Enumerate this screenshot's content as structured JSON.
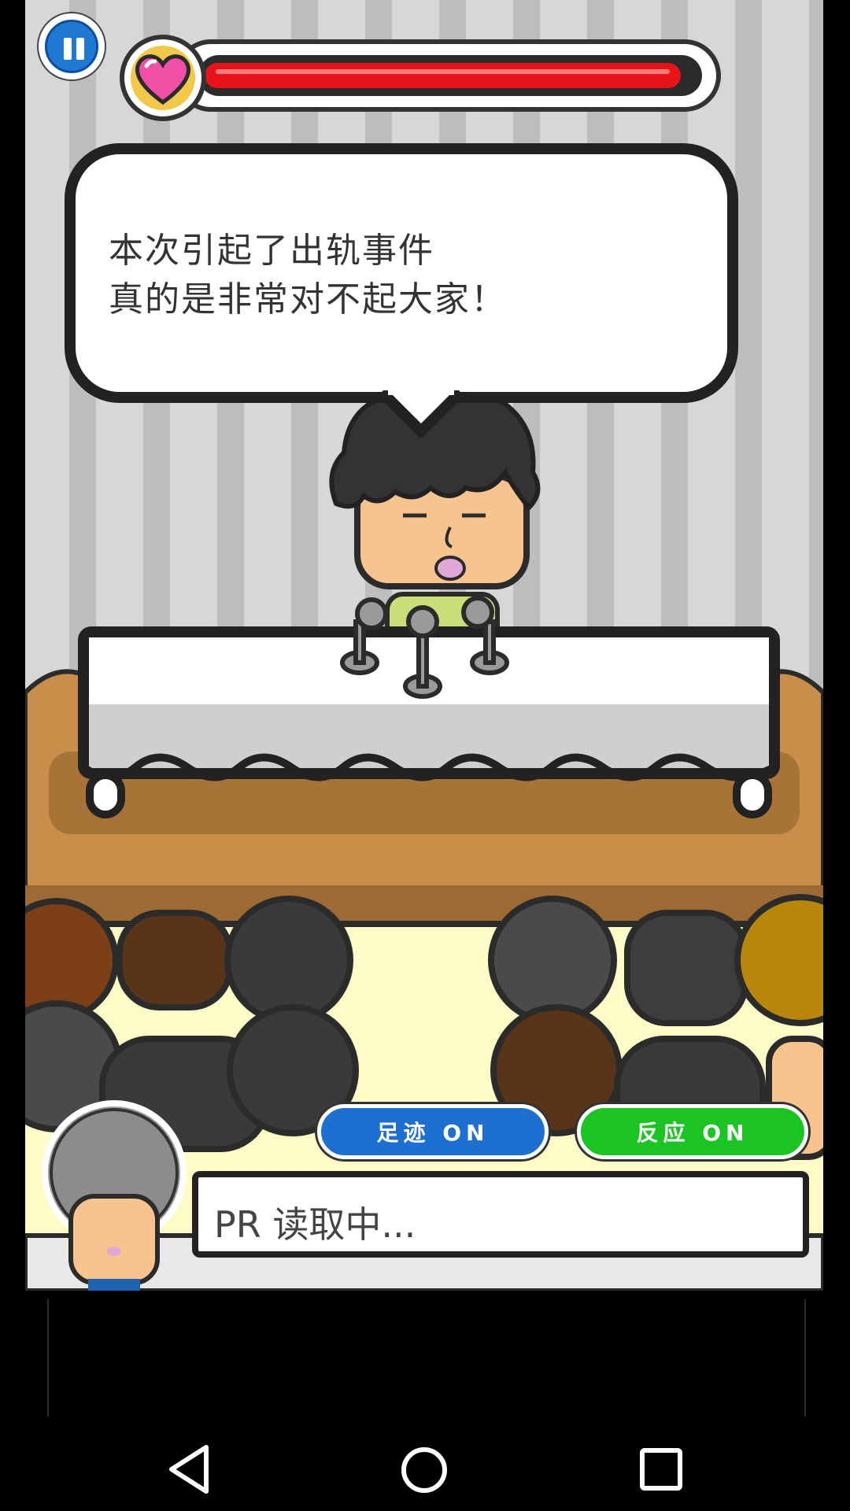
{
  "hud": {
    "pause_icon": "pause-icon",
    "health_icon": "heart-icon",
    "health_fraction": 0.97
  },
  "speech": {
    "line1": "本次引起了出轨事件",
    "line2": "真的是非常对不起大家！"
  },
  "buttons": {
    "footprint_label": "足迹 ON",
    "reaction_label": "反应 ON"
  },
  "status": {
    "text": "PR 读取中..."
  },
  "colors": {
    "health": "#e8141a",
    "blue_button": "#1d6fd0",
    "green_button": "#1bc323",
    "heart_badge": "#f2c84b",
    "stage": "#c98f4a"
  },
  "navbar": {
    "back_icon": "back-triangle-icon",
    "home_icon": "home-circle-icon",
    "recents_icon": "recents-square-icon"
  }
}
